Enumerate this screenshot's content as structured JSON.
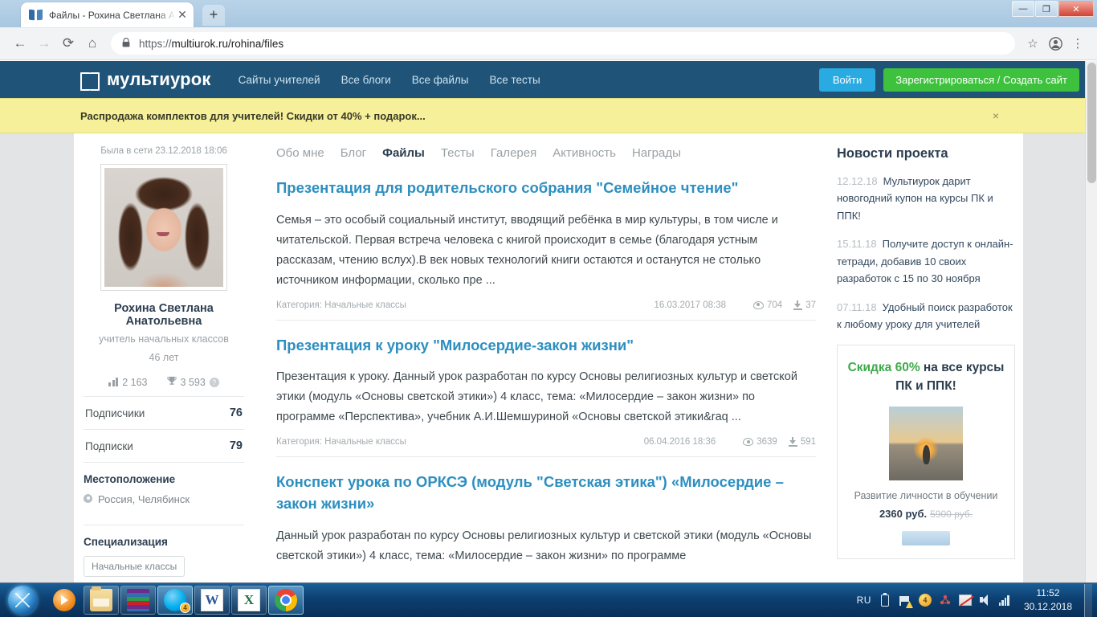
{
  "browser": {
    "tab_title": "Файлы - Рохина Светлана Анато",
    "tab_close": "✕",
    "new_tab": "+",
    "back": "←",
    "forward": "→",
    "reload": "⟳",
    "home": "⌂",
    "lock": "🔒",
    "url_scheme": "https://",
    "url_rest": "multiurok.ru/rohina/files",
    "star": "☆",
    "profile": "◉",
    "menu": "⋮",
    "window_minimize": "—",
    "window_restore": "❐",
    "window_close": "✕"
  },
  "site_header": {
    "logo_text": "мультиурок",
    "nav": [
      {
        "label": "Сайты учителей"
      },
      {
        "label": "Все блоги"
      },
      {
        "label": "Все файлы"
      },
      {
        "label": "Все тесты"
      }
    ],
    "login_label": "Войти",
    "register_label": "Зарегистрироваться / Создать сайт"
  },
  "banner": {
    "text": "Распродажа комплектов для учителей! Скидки от 40% + подарок...",
    "close": "×"
  },
  "profile": {
    "last_seen": "Была в сети 23.12.2018 18:06",
    "name": "Рохина Светлана Анатольевна",
    "role": "учитель начальных классов",
    "age": "46 лет",
    "rating_value": "2 163",
    "points_value": "3 593",
    "help_mark": "?",
    "subscribers_label": "Подписчики",
    "subscribers_value": "76",
    "subscriptions_label": "Подписки",
    "subscriptions_value": "79",
    "location_label": "Местоположение",
    "location_value": "Россия, Челябинск",
    "specialization_label": "Специализация",
    "specialization_tag": "Начальные классы"
  },
  "tabs": [
    {
      "label": "Обо мне",
      "active": false
    },
    {
      "label": "Блог",
      "active": false
    },
    {
      "label": "Файлы",
      "active": true
    },
    {
      "label": "Тесты",
      "active": false
    },
    {
      "label": "Галерея",
      "active": false
    },
    {
      "label": "Активность",
      "active": false
    },
    {
      "label": "Награды",
      "active": false
    }
  ],
  "files": [
    {
      "title": "Презентация для родительского собрания \"Семейное чтение\"",
      "description": "Семья – это особый социальный институт, вводящий ребёнка в мир культуры, в том числе и читательской. Первая встреча человека с книгой происходит в семье (благодаря устным рассказам, чтению вслух).В век новых технологий книги остаются и останутся не столько источником информации, сколько пре ...",
      "category": "Категория: Начальные классы",
      "date": "16.03.2017 08:38",
      "views": "704",
      "downloads": "37"
    },
    {
      "title": "Презентация к уроку \"Милосердие-закон жизни\"",
      "description": "Презентация к уроку. Данный урок разработан по курсу Основы религиозных культур и светской этики (модуль «Основы светской этики») 4 класс, тема: «Милосердие – закон жизни» по программе «Перспектива», учебник А.И.Шемшуриной «Основы светской этики&raq ...",
      "category": "Категория: Начальные классы",
      "date": "06.04.2016 18:36",
      "views": "3639",
      "downloads": "591"
    },
    {
      "title": "Конспект урока по ОРКСЭ (модуль \"Светская этика\") «Милосердие – закон жизни»",
      "description": "Данный урок разработан по курсу Основы религиозных культур и светской этики (модуль «Основы светской этики») 4 класс, тема: «Милосердие – закон жизни» по программе",
      "category": "",
      "date": "",
      "views": "",
      "downloads": ""
    }
  ],
  "news": {
    "heading": "Новости проекта",
    "items": [
      {
        "date": "12.12.18",
        "text": "Мультиурок дарит новогодний купон на курсы ПК и ППК!"
      },
      {
        "date": "15.11.18",
        "text": "Получите доступ к онлайн-тетради, добавив 10 своих разработок с 15 по 30 ноября"
      },
      {
        "date": "07.11.18",
        "text": "Удобный поиск разработок к любому уроку для учителей"
      }
    ]
  },
  "promo": {
    "title_discount": "Скидка 60%",
    "title_rest": " на все курсы ПК и ППК!",
    "caption": "Развитие личности в обучении",
    "price": "2360 руб.",
    "old_price": "5900 руб."
  },
  "taskbar": {
    "start": "start-orb",
    "items": [
      {
        "name": "media-player-icon",
        "glyph": "g-wmp",
        "boxed": false,
        "active": false,
        "badge": ""
      },
      {
        "name": "file-explorer-icon",
        "glyph": "g-folder",
        "boxed": true,
        "active": false,
        "badge": ""
      },
      {
        "name": "winrar-icon",
        "glyph": "g-rar",
        "boxed": true,
        "active": false,
        "badge": ""
      },
      {
        "name": "skype-icon",
        "glyph": "g-skype",
        "boxed": true,
        "active": true,
        "badge": "4"
      },
      {
        "name": "word-icon",
        "glyph": "g-word",
        "boxed": true,
        "active": false,
        "badge": ""
      },
      {
        "name": "excel-icon",
        "glyph": "g-excel",
        "boxed": true,
        "active": false,
        "badge": ""
      },
      {
        "name": "chrome-icon",
        "glyph": "g-chrome",
        "boxed": true,
        "active": true,
        "badge": ""
      }
    ],
    "language": "RU",
    "time": "11:52",
    "date": "30.12.2018"
  },
  "colors": {
    "header_blue": "#1f5478",
    "banner_yellow": "#f6f09a",
    "link_blue": "#2d8fc0",
    "login_blue": "#29abe2",
    "register_green": "#3ec23e",
    "discount_green": "#3fa94b"
  }
}
